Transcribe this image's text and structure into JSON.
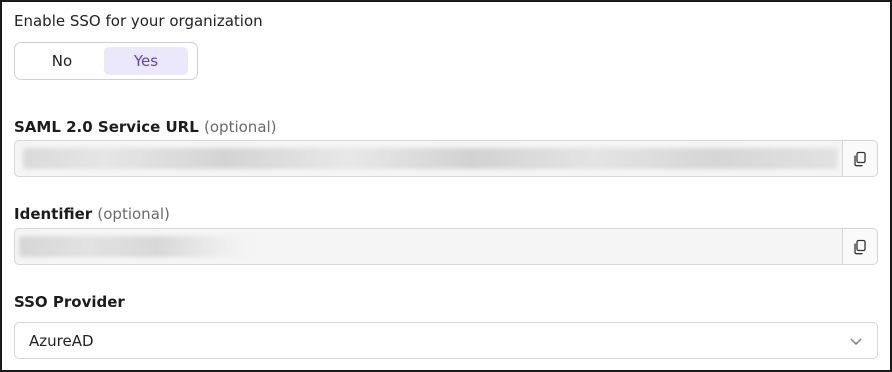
{
  "sso_toggle": {
    "label": "Enable SSO for your organization",
    "options": [
      "No",
      "Yes"
    ],
    "selected": "Yes"
  },
  "saml_url": {
    "label": "SAML 2.0 Service URL",
    "optional": "(optional)",
    "value_hidden": true,
    "copy_icon": "copy-icon"
  },
  "identifier": {
    "label": "Identifier",
    "optional": "(optional)",
    "value_hidden": true,
    "copy_icon": "copy-icon"
  },
  "sso_provider": {
    "label": "SSO Provider",
    "value": "AzureAD",
    "icon": "chevron-down-icon"
  },
  "colors": {
    "accent": "#5b45c5",
    "accent_bg": "#ebe8fb",
    "field_bg": "#f5f5f6",
    "border": "#d6d6da"
  }
}
